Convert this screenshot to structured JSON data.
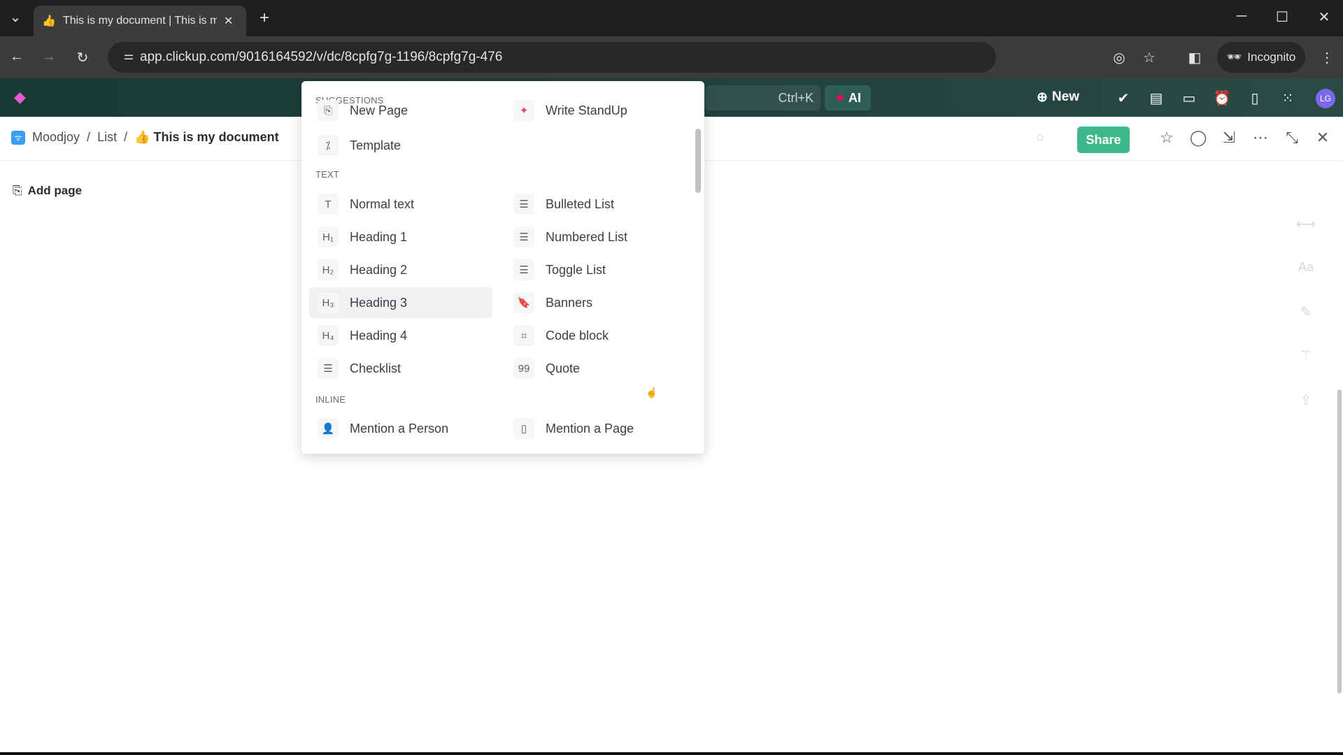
{
  "browser": {
    "tab_title": "This is my document | This is my document",
    "url": "app.clickup.com/9016164592/v/dc/8cpfg7g-1196/8cpfg7g-476",
    "profile": "Incognito"
  },
  "toolbar": {
    "search_shortcut": "Ctrl+K",
    "ai_label": "AI",
    "new_label": "New",
    "avatar": "LG"
  },
  "breadcrumb": [
    "Moodjoy",
    "List",
    "This is my document"
  ],
  "doc": {
    "share_label": "Share",
    "add_page": "Add page"
  },
  "menu": {
    "sections": {
      "suggestions": "SUGGESTIONS",
      "text": "TEXT",
      "inline": "INLINE"
    },
    "suggestions": [
      {
        "label": "New Page",
        "icon": "new-page-icon"
      },
      {
        "label": "Write StandUp",
        "icon": "sparkle-icon"
      },
      {
        "label": "Template",
        "icon": "magic-wand-icon"
      }
    ],
    "text": [
      {
        "label": "Normal text",
        "glyph": "T"
      },
      {
        "label": "Bulleted List",
        "glyph": "☰"
      },
      {
        "label": "Heading 1",
        "glyph": "H₁"
      },
      {
        "label": "Numbered List",
        "glyph": "☰"
      },
      {
        "label": "Heading 2",
        "glyph": "H₂"
      },
      {
        "label": "Toggle List",
        "glyph": "☰"
      },
      {
        "label": "Heading 3",
        "glyph": "H₃"
      },
      {
        "label": "Banners",
        "glyph": "🔖"
      },
      {
        "label": "Heading 4",
        "glyph": "H₄"
      },
      {
        "label": "Code block",
        "glyph": "⌗"
      },
      {
        "label": "Checklist",
        "glyph": "☰"
      },
      {
        "label": "Quote",
        "glyph": "99"
      }
    ],
    "inline": [
      {
        "label": "Mention a Person",
        "glyph": "👤"
      },
      {
        "label": "Mention a Page",
        "glyph": "▯"
      }
    ],
    "highlighted": "Heading 3"
  },
  "colors": {
    "share": "#3db88b",
    "toolbar": "#1f403a",
    "avatar": "#7b68ee"
  }
}
